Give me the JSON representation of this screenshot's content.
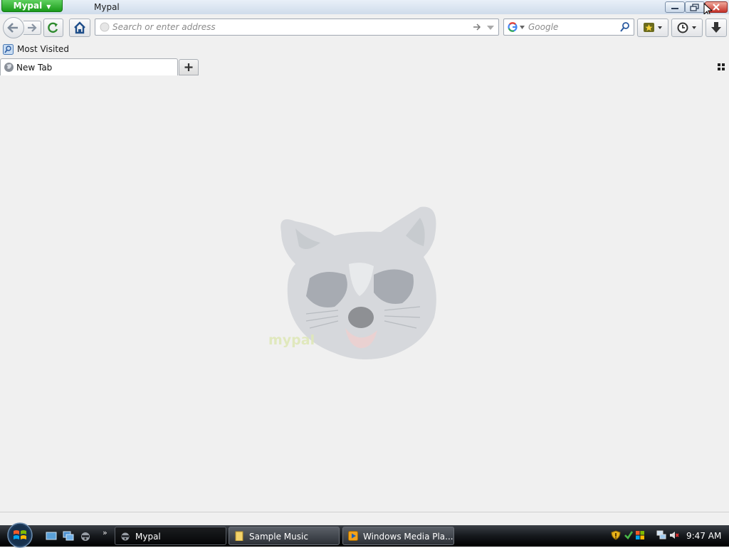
{
  "window": {
    "app_menu_label": "Mypal",
    "title": "Mypal"
  },
  "navbar": {
    "url_placeholder": "Search or enter address",
    "search_placeholder": "Google"
  },
  "bookmarks_toolbar": {
    "items": [
      {
        "label": "Most Visited",
        "icon": "most-visited-icon"
      }
    ]
  },
  "tabs": [
    {
      "label": "New Tab",
      "icon": "globe-icon",
      "active": true
    }
  ],
  "content": {
    "logo_text": "mypal"
  },
  "taskbar": {
    "items": [
      {
        "label": "Mypal",
        "icon": "raccoon-icon",
        "active": true
      },
      {
        "label": "Sample Music",
        "icon": "folder-icon",
        "active": false
      },
      {
        "label": "Windows Media Pla...",
        "icon": "media-player-icon",
        "active": false
      }
    ],
    "clock": "9:47 AM"
  },
  "colors": {
    "app_menu_green": "#1a9a1a",
    "close_red": "#c4322a",
    "taskbar_black": "#15181c",
    "content_bg": "#f0f0f0"
  }
}
